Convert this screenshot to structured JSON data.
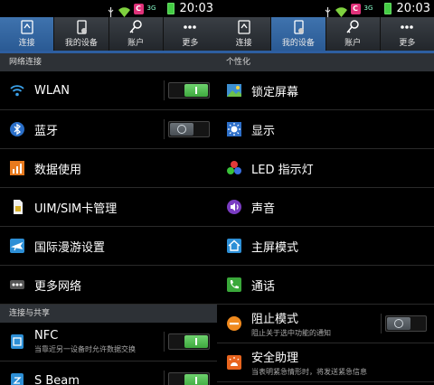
{
  "status_bar": {
    "time": "20:03",
    "carrier_badge": "C",
    "signal_text": "3G"
  },
  "left": {
    "tabs": [
      {
        "label": "连接",
        "active": true,
        "icon": "connections-icon"
      },
      {
        "label": "我的设备",
        "active": false,
        "icon": "device-icon"
      },
      {
        "label": "账户",
        "active": false,
        "icon": "key-icon"
      },
      {
        "label": "更多",
        "active": false,
        "icon": "more-icon"
      }
    ],
    "section1": "网络连接",
    "rows1": [
      {
        "title": "WLAN",
        "icon": "wifi-icon",
        "toggle": "on"
      },
      {
        "title": "蓝牙",
        "icon": "bluetooth-icon",
        "toggle": "off"
      },
      {
        "title": "数据使用",
        "icon": "data-usage-icon"
      },
      {
        "title": "UIM/SIM卡管理",
        "icon": "sim-card-icon"
      },
      {
        "title": "国际漫游设置",
        "icon": "airplane-icon"
      },
      {
        "title": "更多网络",
        "icon": "more-networks-icon"
      }
    ],
    "section2": "连接与共享",
    "rows2": [
      {
        "title": "NFC",
        "subtitle": "当靠近另一设备时允许数据交换",
        "icon": "nfc-icon",
        "toggle": "on"
      },
      {
        "title": "S Beam",
        "subtitle": "",
        "icon": "sbeam-icon",
        "toggle": "on"
      }
    ]
  },
  "right": {
    "tabs": [
      {
        "label": "连接",
        "active": false
      },
      {
        "label": "我的设备",
        "active": true
      },
      {
        "label": "账户",
        "active": false
      },
      {
        "label": "更多",
        "active": false
      }
    ],
    "section1": "个性化",
    "rows": [
      {
        "title": "锁定屏幕",
        "icon": "lock-screen-icon"
      },
      {
        "title": "显示",
        "icon": "display-icon"
      },
      {
        "title": "LED 指示灯",
        "icon": "led-indicator-icon"
      },
      {
        "title": "声音",
        "icon": "sound-icon"
      },
      {
        "title": "主屏模式",
        "icon": "home-screen-icon"
      },
      {
        "title": "通话",
        "icon": "call-icon"
      },
      {
        "title": "阻止模式",
        "subtitle": "阻止关于选中功能的通知",
        "icon": "blocking-mode-icon",
        "toggle": "off"
      },
      {
        "title": "安全助理",
        "subtitle": "当表明紧急情形时，将发送紧急信息",
        "icon": "safety-assistant-icon"
      }
    ]
  },
  "colors": {
    "accent": "#2d5ea0",
    "toggle_on": "#4cbb4c",
    "section_bg": "#2d3136"
  }
}
